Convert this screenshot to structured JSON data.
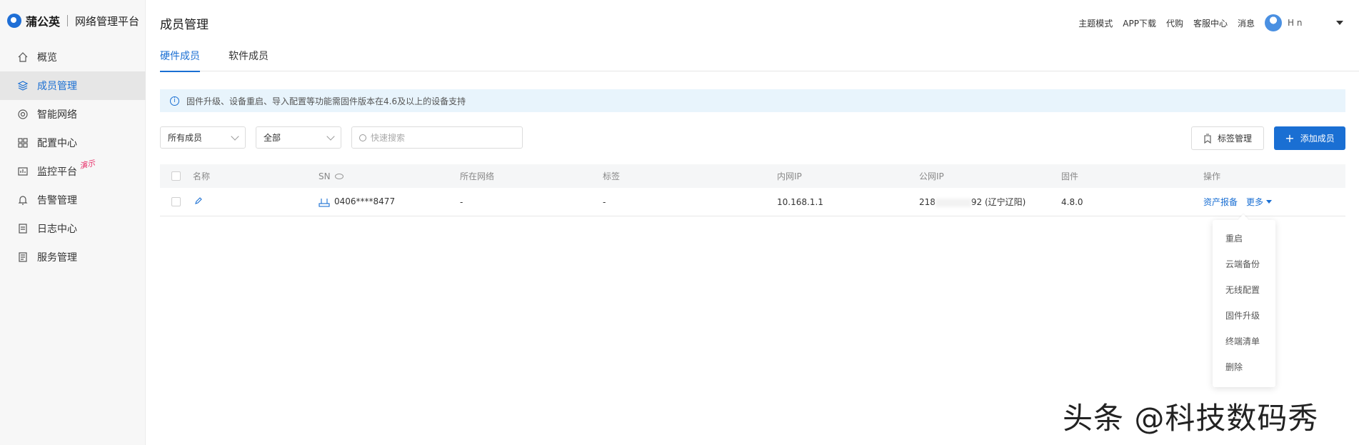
{
  "brand": {
    "name": "蒲公英",
    "subtitle": "网络管理平台"
  },
  "sidebar": {
    "items": [
      {
        "label": "概览",
        "icon": "home-icon"
      },
      {
        "label": "成员管理",
        "icon": "layers-icon",
        "active": true
      },
      {
        "label": "智能网络",
        "icon": "network-icon"
      },
      {
        "label": "配置中心",
        "icon": "grid-icon"
      },
      {
        "label": "监控平台",
        "icon": "monitor-icon",
        "tag": "演示"
      },
      {
        "label": "告警管理",
        "icon": "bell-icon"
      },
      {
        "label": "日志中心",
        "icon": "log-icon"
      },
      {
        "label": "服务管理",
        "icon": "service-icon"
      }
    ]
  },
  "header": {
    "title": "成员管理",
    "links": [
      "主题模式",
      "APP下载",
      "代购",
      "客服中心",
      "消息"
    ],
    "user_name": "H     n"
  },
  "tabs": [
    {
      "label": "硬件成员",
      "active": true
    },
    {
      "label": "软件成员",
      "active": false
    }
  ],
  "notice": "固件升级、设备重启、导入配置等功能需固件版本在4.6及以上的设备支持",
  "filters": {
    "member_select": "所有成员",
    "scope_select": "全部",
    "search_placeholder": "快速搜索"
  },
  "actions": {
    "tag_manage": "标签管理",
    "add_member": "添加成员"
  },
  "table": {
    "headers": [
      "名称",
      "SN",
      "所在网络",
      "标签",
      "内网IP",
      "公网IP",
      "固件",
      "操作"
    ],
    "rows": [
      {
        "name": "",
        "sn": "0406****8477",
        "network": "-",
        "tag": "-",
        "lan_ip": "10.168.1.1",
        "wan_ip_prefix": "218",
        "wan_ip_suffix": "92 (辽宁辽阳)",
        "firmware": "4.8.0",
        "op_report": "资产报备",
        "op_more": "更多"
      }
    ]
  },
  "more_menu": [
    "重启",
    "云端备份",
    "无线配置",
    "固件升级",
    "终端清单",
    "删除"
  ],
  "watermark": "头条 @科技数码秀",
  "colors": {
    "accent": "#1a6fd3",
    "demo_tag": "#e8306a"
  }
}
